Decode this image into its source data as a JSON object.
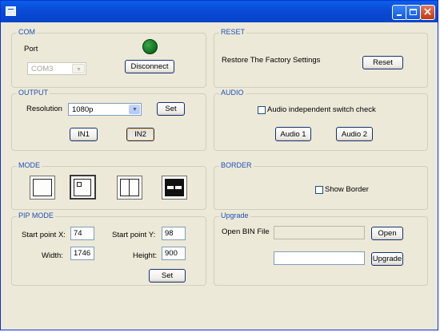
{
  "window": {
    "title": ""
  },
  "com": {
    "title": "COM",
    "port_label": "Port",
    "port_value": "COM3",
    "connect_button": "Disconnect",
    "status_color": "#1d8a2f"
  },
  "reset": {
    "title": "RESET",
    "description": "Restore The Factory Settings",
    "button": "Reset"
  },
  "output": {
    "title": "OUTPUT",
    "resolution_label": "Resolution",
    "resolution_value": "1080p",
    "set_button": "Set",
    "in1_button": "IN1",
    "in2_button": "IN2"
  },
  "audio": {
    "title": "AUDIO",
    "switch_check_label": "Audio independent switch check",
    "switch_check_checked": false,
    "audio1_button": "Audio 1",
    "audio2_button": "Audio 2"
  },
  "mode": {
    "title": "MODE",
    "options": [
      "single-view",
      "picture-in-picture",
      "side-by-side",
      "top-bottom"
    ],
    "selected": "picture-in-picture"
  },
  "border": {
    "title": "BORDER",
    "show_border_label": "Show Border",
    "show_border_checked": false
  },
  "pip": {
    "title": "PIP MODE",
    "start_x_label": "Start point X:",
    "start_x_value": "74",
    "start_y_label": "Start point Y:",
    "start_y_value": "98",
    "width_label": "Width:",
    "width_value": "1746",
    "height_label": "Height:",
    "height_value": "900",
    "set_button": "Set"
  },
  "upgrade": {
    "title": "Upgrade",
    "open_bin_label": "Open BIN File",
    "bin_path_value": "",
    "open_button": "Open",
    "upgrade_field_value": "",
    "upgrade_button": "Upgrade"
  },
  "icons": {
    "app": "app-icon",
    "minimize": "minimize-icon",
    "maximize": "maximize-icon",
    "close": "close-icon",
    "dropdown": "chevron-down-icon"
  }
}
